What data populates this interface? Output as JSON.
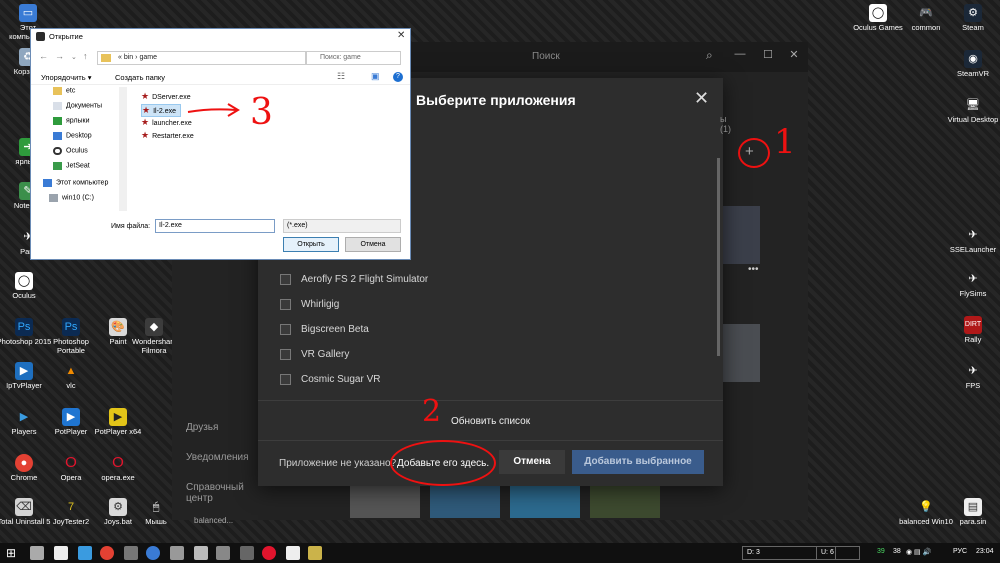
{
  "desktop": {
    "left_icons": [
      {
        "label": "Этот компьютер",
        "icon": "computer-icon"
      },
      {
        "label": "Корзина",
        "icon": "recycle-bin-icon"
      },
      {
        "label": "ярлыки",
        "icon": "shortcuts-icon"
      },
      {
        "label": "Notepad",
        "icon": "notepad-icon"
      },
      {
        "label": "Para",
        "icon": "app-icon"
      },
      {
        "label": "Oculus",
        "icon": "oculus-icon"
      },
      {
        "label": "Photoshop 2015",
        "icon": "photoshop-icon"
      },
      {
        "label": "Photoshop Portable",
        "icon": "photoshop-icon"
      },
      {
        "label": "Paint",
        "icon": "paint-icon"
      },
      {
        "label": "Wondershare Filmora",
        "icon": "filmora-icon"
      },
      {
        "label": "IpTvPlayer",
        "icon": "iptv-icon"
      },
      {
        "label": "vlc",
        "icon": "vlc-icon"
      },
      {
        "label": "Players",
        "icon": "players-icon"
      },
      {
        "label": "PotPlayer",
        "icon": "potplayer-icon"
      },
      {
        "label": "PotPlayer x64",
        "icon": "potplayer-icon"
      },
      {
        "label": "Chrome",
        "icon": "chrome-icon"
      },
      {
        "label": "Opera",
        "icon": "opera-icon"
      },
      {
        "label": "opera.exe",
        "icon": "opera-icon"
      },
      {
        "label": "Total Uninstall 5",
        "icon": "uninstall-icon"
      },
      {
        "label": "JoyTester2",
        "icon": "joytester-icon"
      },
      {
        "label": "Joys.bat",
        "icon": "bat-icon"
      },
      {
        "label": "Мышь",
        "icon": "mouse-icon"
      }
    ],
    "right_icons": [
      {
        "label": "Oculus Games",
        "icon": "oculus-icon"
      },
      {
        "label": "common",
        "icon": "gamepad-icon"
      },
      {
        "label": "Steam",
        "icon": "steam-icon"
      },
      {
        "label": "SteamVR",
        "icon": "steamvr-icon"
      },
      {
        "label": "Virtual Desktop",
        "icon": "virtual-desktop-icon"
      },
      {
        "label": "SSELauncher",
        "icon": "launcher-icon"
      },
      {
        "label": "FlySims",
        "icon": "flysims-icon"
      },
      {
        "label": "Rally",
        "icon": "rally-icon"
      },
      {
        "label": "FPS",
        "icon": "fps-icon"
      },
      {
        "label": "balanced Win10",
        "icon": "bulb-icon"
      },
      {
        "label": "para.sin",
        "icon": "file-icon"
      }
    ]
  },
  "oculus_app": {
    "search_placeholder": "Поиск",
    "sidebar": [
      "Друзья",
      "Уведомления",
      "Справочный центр"
    ],
    "partial_label": "ы (1)",
    "bottom_partial": "balanced..."
  },
  "select_apps_modal": {
    "title": "Выберите приложения",
    "apps": [
      "Aerofly FS 2 Flight Simulator",
      "Whirligig",
      "Bigscreen Beta",
      "VR Gallery",
      "Cosmic Sugar VR"
    ],
    "refresh_label": "Обновить список",
    "not_found_text": "Приложение не указано?",
    "add_here_link": "Добавьте его здесь.",
    "cancel_label": "Отмена",
    "add_selected_label": "Добавить выбранное"
  },
  "file_dialog": {
    "title": "Открытие",
    "path": [
      "«",
      "bin",
      "›",
      "game"
    ],
    "search_placeholder": "Поиск: game",
    "organize_label": "Упорядочить ▾",
    "new_folder_label": "Создать папку",
    "tree": [
      {
        "label": "etc",
        "icon": "folder-icon"
      },
      {
        "label": "Документы",
        "icon": "documents-icon"
      },
      {
        "label": "ярлыки",
        "icon": "shortcuts-icon"
      },
      {
        "label": "Desktop",
        "icon": "desktop-icon"
      },
      {
        "label": "Oculus",
        "icon": "oculus-icon"
      },
      {
        "label": "JetSeat",
        "icon": "jetseat-icon"
      },
      {
        "label": "Этот компьютер",
        "icon": "computer-icon"
      },
      {
        "label": "win10 (C:)",
        "icon": "drive-icon"
      }
    ],
    "files": [
      "DServer.exe",
      "Il-2.exe",
      "launcher.exe",
      "Restarter.exe"
    ],
    "selected_file": "Il-2.exe",
    "filename_label": "Имя файла:",
    "filename_value": "Il-2.exe",
    "filter_value": "(*.exe)",
    "open_label": "Открыть",
    "cancel_label": "Отмена"
  },
  "annotations": {
    "one": "1",
    "two": "2",
    "three": "3"
  },
  "taskbar": {
    "d_counter": "D: 3",
    "u_counter": "U: 6",
    "num1": "39",
    "num2": "38",
    "language": "РУС",
    "time": "23:04"
  }
}
